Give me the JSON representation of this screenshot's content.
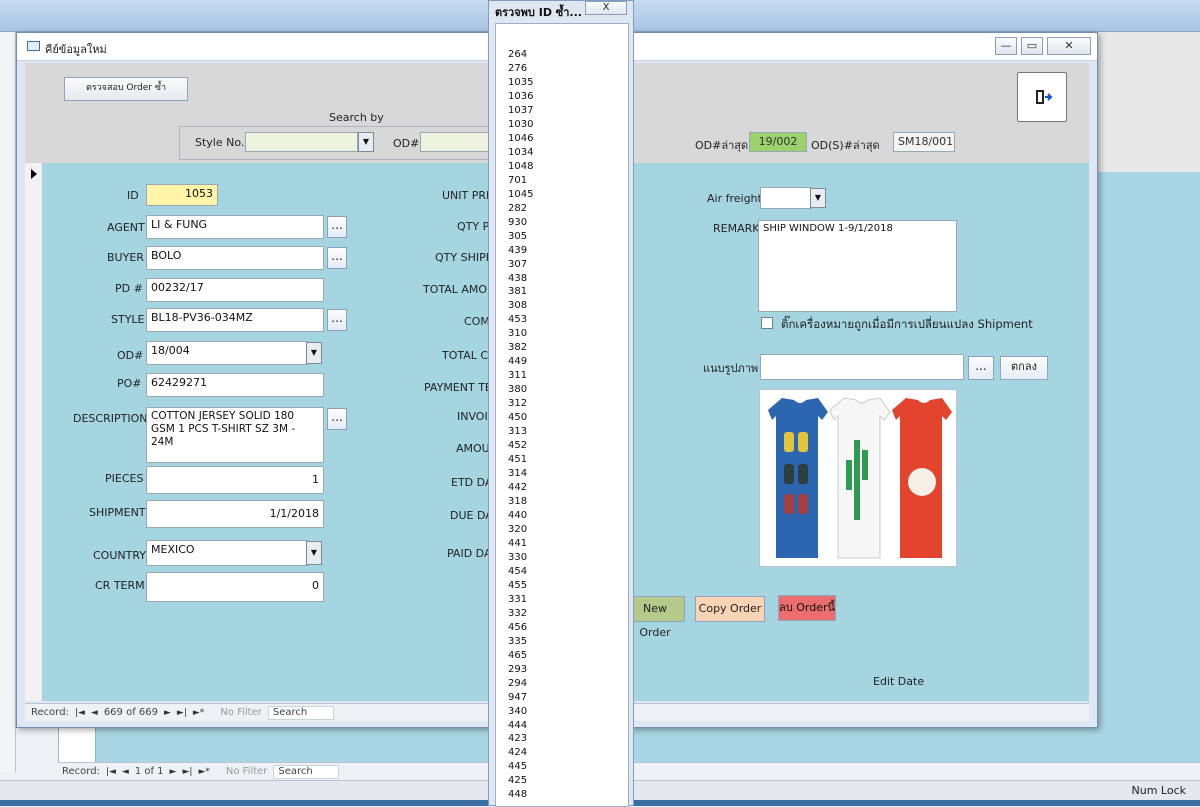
{
  "main_window": {
    "title": "คีย์ข้อมูลใหม่",
    "check_duplicate_button": "ตรวจสอบ Order ซ้ำ",
    "search_by_label": "Search by",
    "style_no_label": "Style No.",
    "style_no_value": "",
    "od_label": "OD#",
    "od_value": "",
    "last_od_label": "OD#ล่าสุด",
    "last_od_value": "19/002",
    "last_ods_label": "OD(S)#ล่าสุด",
    "last_ods_value": "SM18/001"
  },
  "form_left": {
    "id_label": "ID",
    "id_value": "1053",
    "agent_label": "AGENT",
    "agent_value": "LI & FUNG",
    "buyer_label": "BUYER",
    "buyer_value": "BOLO",
    "pd_label": "PD #",
    "pd_value": "00232/17",
    "style_label": "STYLE",
    "style_value": "BL18-PV36-034MZ",
    "od_label": "OD#",
    "od_value": "18/004",
    "po_label": "PO#",
    "po_value": "62429271",
    "description_label": "DESCRIPTION",
    "description_value": "COTTON JERSEY SOLID 180\nGSM 1 PCS T-SHIRT SZ 3M - 24M",
    "pieces_label": "PIECES",
    "pieces_value": "1",
    "shipment_label": "SHIPMENT",
    "shipment_value": "1/1/2018",
    "country_label": "COUNTRY",
    "country_value": "MEXICO",
    "cr_term_label": "CR TERM",
    "cr_term_value": "0"
  },
  "form_middle": {
    "unit_price_label": "UNIT PRIC",
    "qty_po_label": "QTY PO",
    "qty_shipped_label": "QTY SHIPPE",
    "total_amount_label": "TOTAL AMOUN",
    "com_label": "COM",
    "total_com_label": "TOTAL CO",
    "payment_term_label": "PAYMENT TER",
    "invoice_label": "INVOIC",
    "amount_label": "AMOUN",
    "etd_date_label": "ETD DAT",
    "due_date_label": "DUE DAT",
    "paid_date_label": "PAID DAT"
  },
  "form_right": {
    "air_freight_label": "Air freight",
    "air_freight_value": "",
    "remark_label": "REMARK",
    "remark_value": "SHIP WINDOW 1-9/1/2018",
    "checkbox_label": "ติ๊กเครื่องหมายถูกเมื่อมีการเปลี่ยนแปลง Shipment",
    "attach_label": "แนบรูปภาพ",
    "attach_value": "",
    "ok_button": "ตกลง",
    "new_order_button": "New Order",
    "copy_order_button": "Copy Order",
    "delete_order_button": "ลบ Orderนี้",
    "edit_date_label": "Edit Date"
  },
  "record_nav": {
    "label": "Record:",
    "position": "669 of 669",
    "filter": "No Filter",
    "search": "Search"
  },
  "bg_record_nav": {
    "label": "Record:",
    "position": "1 of 1",
    "filter": "No Filter",
    "search": "Search"
  },
  "status_bar": {
    "num_lock": "Num Lock"
  },
  "popup": {
    "title": "ตรวจพบ ID ซ้ำ...",
    "close": "X",
    "ids": [
      "264",
      "276",
      "1035",
      "1036",
      "1037",
      "1030",
      "1046",
      "1034",
      "1048",
      "701",
      "1045",
      "282",
      "930",
      "305",
      "439",
      "307",
      "438",
      "381",
      "308",
      "453",
      "310",
      "382",
      "449",
      "311",
      "380",
      "312",
      "450",
      "313",
      "452",
      "451",
      "314",
      "442",
      "318",
      "440",
      "320",
      "441",
      "330",
      "454",
      "455",
      "331",
      "332",
      "456",
      "335",
      "465",
      "293",
      "294",
      "947",
      "340",
      "444",
      "423",
      "424",
      "445",
      "425",
      "448"
    ]
  },
  "colors": {
    "form_bg": "#a6d5e2",
    "last_od_bg": "#9cd26e",
    "id_bg": "#fff4a8",
    "new_order_bg": "#b5c98a",
    "copy_order_bg": "#f8d4b4",
    "delete_order_bg": "#ec6d6d"
  }
}
